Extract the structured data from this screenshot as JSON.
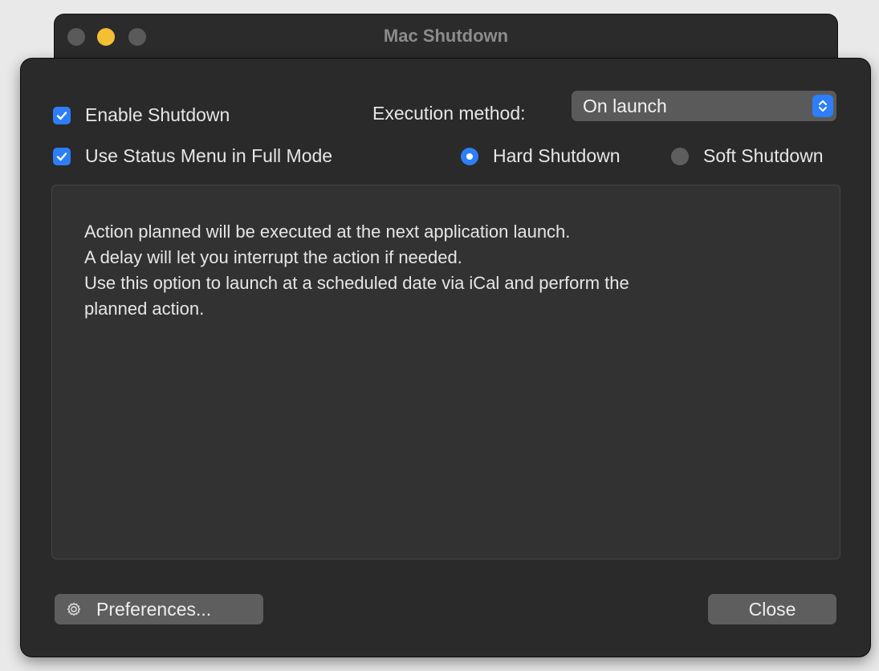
{
  "window": {
    "title": "Mac Shutdown"
  },
  "options": {
    "enable_shutdown": {
      "label": "Enable Shutdown",
      "checked": true
    },
    "status_menu": {
      "label": "Use Status Menu in Full Mode",
      "checked": true
    },
    "execution_method_label": "Execution method:",
    "execution_method_value": "On launch",
    "shutdown_mode": {
      "hard": {
        "label": "Hard Shutdown",
        "selected": true
      },
      "soft": {
        "label": "Soft Shutdown",
        "selected": false
      }
    }
  },
  "description": {
    "lines": [
      "Action planned will be executed at the next application launch.",
      "A delay will let you interrupt the action if needed.",
      "Use this option to launch at a scheduled date via iCal and perform the",
      "planned action."
    ]
  },
  "footer": {
    "preferences_label": "Preferences...",
    "close_label": "Close"
  },
  "icons": {
    "checkbox": "checkmark-icon",
    "select": "chevron-updown-icon",
    "preferences": "gear-icon"
  },
  "colors": {
    "accent": "#2d7ef7",
    "minimize": "#f4bf34",
    "window_bg": "#2a2a2a"
  }
}
